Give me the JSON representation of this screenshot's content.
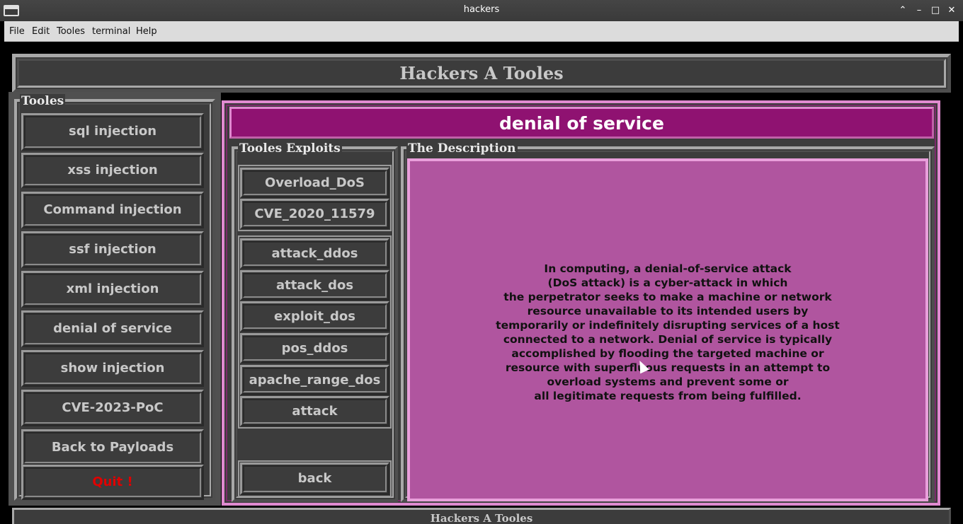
{
  "window": {
    "title": "hackers",
    "controls": {
      "maximize_up": "⌃",
      "minimize": "–",
      "restore": "□",
      "close": "✕"
    }
  },
  "menu": [
    "File",
    "Edit",
    "Tooles",
    "terminal",
    "Help"
  ],
  "header": {
    "title": "Hackers A Tooles"
  },
  "tooles": {
    "legend": "Tooles",
    "buttons": [
      "sql injection",
      "xss injection",
      "Command injection",
      "ssf injection",
      "xml injection",
      "denial of service",
      "show injection",
      "CVE-2023-PoC",
      "Back to Payloads"
    ],
    "quit": "Quit !"
  },
  "panel": {
    "title": "denial of service",
    "exploits_legend": "Tooles Exploits",
    "exploits_group1": [
      "Overload_DoS",
      "CVE_2020_11579"
    ],
    "exploits_group2": [
      "attack_ddos",
      "attack_dos",
      "exploit_dos",
      "pos_ddos",
      "apache_range_dos",
      "attack"
    ],
    "back": "back",
    "description_legend": "The Description",
    "description_lines": [
      "In computing, a denial-of-service attack",
      "(DoS attack) is a cyber-attack in which",
      "the perpetrator seeks to make a machine or network",
      "resource unavailable to its intended users by",
      "temporarily or indefinitely disrupting services of a host",
      "connected to a network. Denial of service is typically",
      "accomplished by flooding the targeted machine or",
      "resource with superfluous requests in an attempt to",
      "overload systems and prevent some or",
      "all legitimate requests from being fulfilled."
    ]
  },
  "status": {
    "text": "Hackers A Tooles"
  },
  "colors": {
    "accent": "#8f1271",
    "description_bg": "#b0559f",
    "quit": "#e00000"
  }
}
